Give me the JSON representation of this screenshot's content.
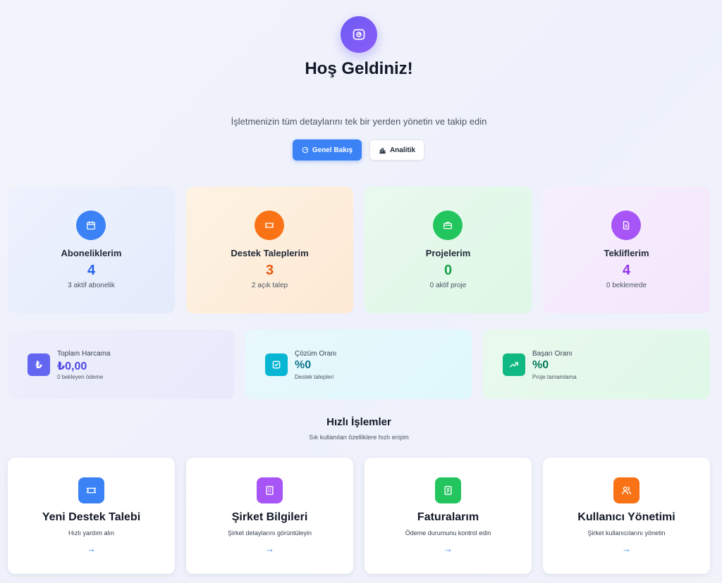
{
  "header": {
    "title": "Hoş Geldiniz!",
    "subtitle": "İşletmenizin tüm detaylarını tek bir yerden yönetin ve takip edin",
    "icon": "gauge-icon"
  },
  "tabs": [
    {
      "label": "Genel Bakış",
      "icon": "gauge-icon",
      "active": true
    },
    {
      "label": "Analitik",
      "icon": "bar-chart-icon",
      "active": false
    }
  ],
  "stats": [
    {
      "label": "Aboneliklerim",
      "value": "4",
      "note": "3 aktif abonelik",
      "icon": "calendar-icon",
      "color": "#3b82f6"
    },
    {
      "label": "Destek Taleplerim",
      "value": "3",
      "note": "2 açık talep",
      "icon": "ticket-icon",
      "color": "#f97316"
    },
    {
      "label": "Projelerim",
      "value": "0",
      "note": "0 aktif proje",
      "icon": "briefcase-icon",
      "color": "#22c55e"
    },
    {
      "label": "Tekliflerim",
      "value": "4",
      "note": "0 beklemede",
      "icon": "document-icon",
      "color": "#a855f7"
    }
  ],
  "metrics": [
    {
      "label": "Toplam Harcama",
      "value": "₺0,00",
      "note": "0 bekleyen ödeme",
      "icon": "lira-icon",
      "color": "#6366f1",
      "value_color": "#4f46e5"
    },
    {
      "label": "Çözüm Oranı",
      "value": "%0",
      "note": "Destek talepleri",
      "icon": "check-square-icon",
      "color": "#06b6d4",
      "value_color": "#0e7490"
    },
    {
      "label": "Başarı Oranı",
      "value": "%0",
      "note": "Proje tamamlama",
      "icon": "trending-up-icon",
      "color": "#10b981",
      "value_color": "#047857"
    }
  ],
  "quick_actions": {
    "title": "Hızlı İşlemler",
    "subtitle": "Sık kullanılan özelliklere hızlı erişim",
    "items": [
      {
        "title": "Yeni Destek Talebi",
        "note": "Hızlı yardım alın",
        "icon": "ticket-icon",
        "color": "#3b82f6"
      },
      {
        "title": "Şirket Bilgileri",
        "note": "Şirket detaylarını görüntüleyin",
        "icon": "building-icon",
        "color": "#a855f7"
      },
      {
        "title": "Faturalarım",
        "note": "Ödeme durumunu kontrol edin",
        "icon": "receipt-icon",
        "color": "#22c55e"
      },
      {
        "title": "Kullanıcı Yönetimi",
        "note": "Şirket kullanıcılarını yönetin",
        "icon": "users-icon",
        "color": "#f97316"
      }
    ]
  }
}
